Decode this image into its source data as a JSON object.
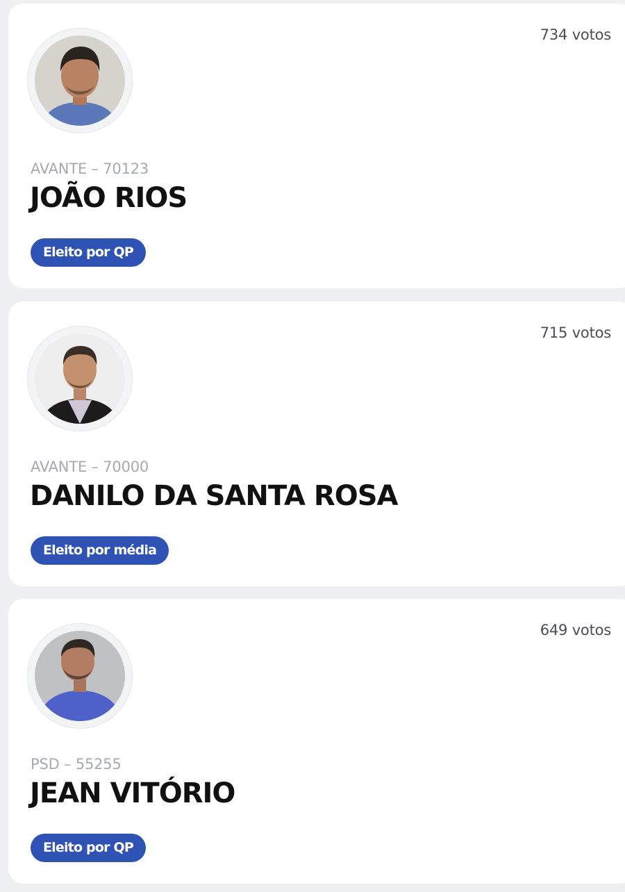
{
  "candidates": [
    {
      "votes": "734 votos",
      "party": "AVANTE – 70123",
      "name": "JOÃO RIOS",
      "status": "Eleito por QP",
      "photo_icon": "candidate-photo-icon"
    },
    {
      "votes": "715 votos",
      "party": "AVANTE – 70000",
      "name": "DANILO DA SANTA ROSA",
      "status": "Eleito por média",
      "photo_icon": "candidate-photo-icon"
    },
    {
      "votes": "649 votos",
      "party": "PSD – 55255",
      "name": "JEAN VITÓRIO",
      "status": "Eleito por QP",
      "photo_icon": "candidate-photo-icon"
    }
  ],
  "colors": {
    "page_bg": "#eef0f1",
    "card_bg": "#ffffff",
    "badge_bg": "#2f53b4",
    "party_text": "#a3aab3",
    "name_text": "#111111"
  }
}
